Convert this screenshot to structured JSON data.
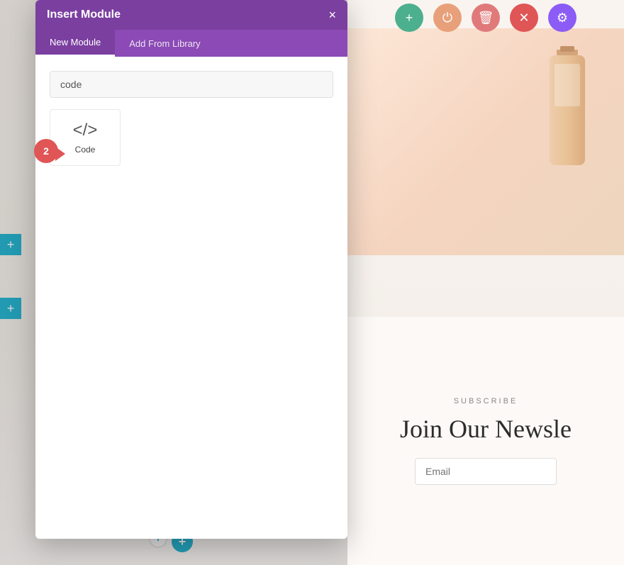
{
  "modal": {
    "title": "Insert Module",
    "close_label": "×",
    "tabs": [
      {
        "id": "new-module",
        "label": "New Module",
        "active": true
      },
      {
        "id": "add-from-library",
        "label": "Add From Library",
        "active": false
      }
    ],
    "search": {
      "placeholder": "code",
      "value": "code"
    },
    "modules": [
      {
        "id": "code",
        "icon": "</>",
        "label": "Code"
      }
    ]
  },
  "toolbar": {
    "buttons": [
      {
        "id": "add",
        "icon": "+",
        "style": "green"
      },
      {
        "id": "power",
        "icon": "⏻",
        "style": "orange"
      },
      {
        "id": "delete",
        "icon": "🗑",
        "style": "red-light"
      },
      {
        "id": "close",
        "icon": "×",
        "style": "red"
      },
      {
        "id": "settings",
        "icon": "⚙",
        "style": "purple"
      }
    ]
  },
  "subscribe": {
    "label": "SUBSCRIBE",
    "title": "Join Our Newsle",
    "email_placeholder": "Email"
  },
  "sidebar": {
    "add_icon": "+"
  },
  "badges": {
    "badge1_label": "1",
    "badge_plus_teal": "+"
  },
  "step2": {
    "label": "2"
  }
}
